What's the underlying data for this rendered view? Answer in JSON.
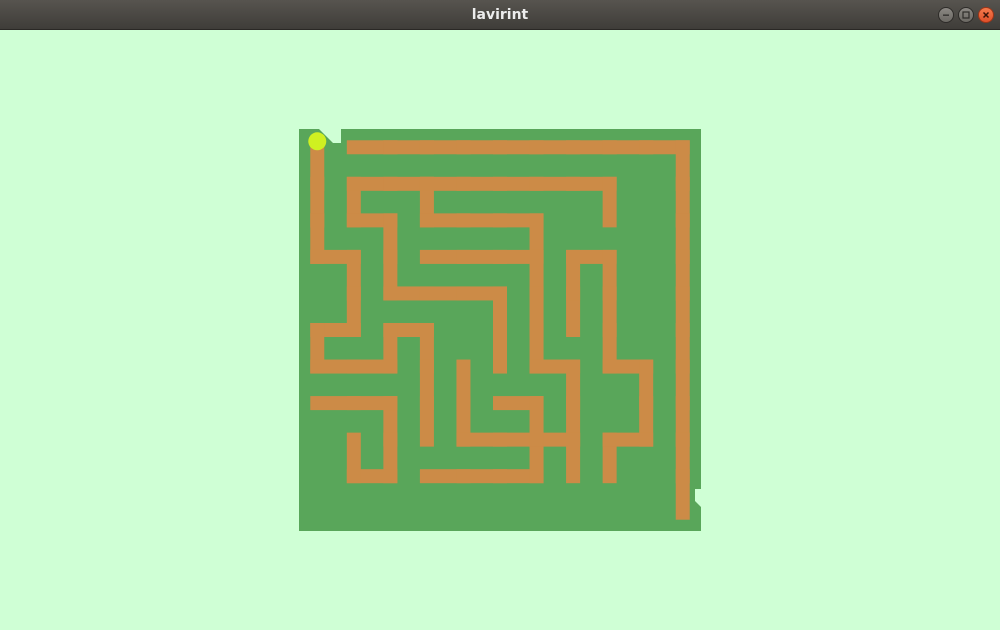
{
  "window": {
    "title": "lavirint",
    "controls": [
      "minimize-icon",
      "maximize-icon",
      "close-icon"
    ]
  },
  "colors": {
    "background": "#cfffd5",
    "wall": "#59a65a",
    "path": "#cc8b47",
    "player": "#cff021",
    "titlebar": "#4a4743",
    "close_button": "#e95420"
  },
  "game": {
    "maze_size": 11,
    "player": {
      "row": 0,
      "col": 0
    },
    "entrance": {
      "row": 0,
      "col": 0
    },
    "exit": {
      "row": 10,
      "col": 10
    }
  }
}
